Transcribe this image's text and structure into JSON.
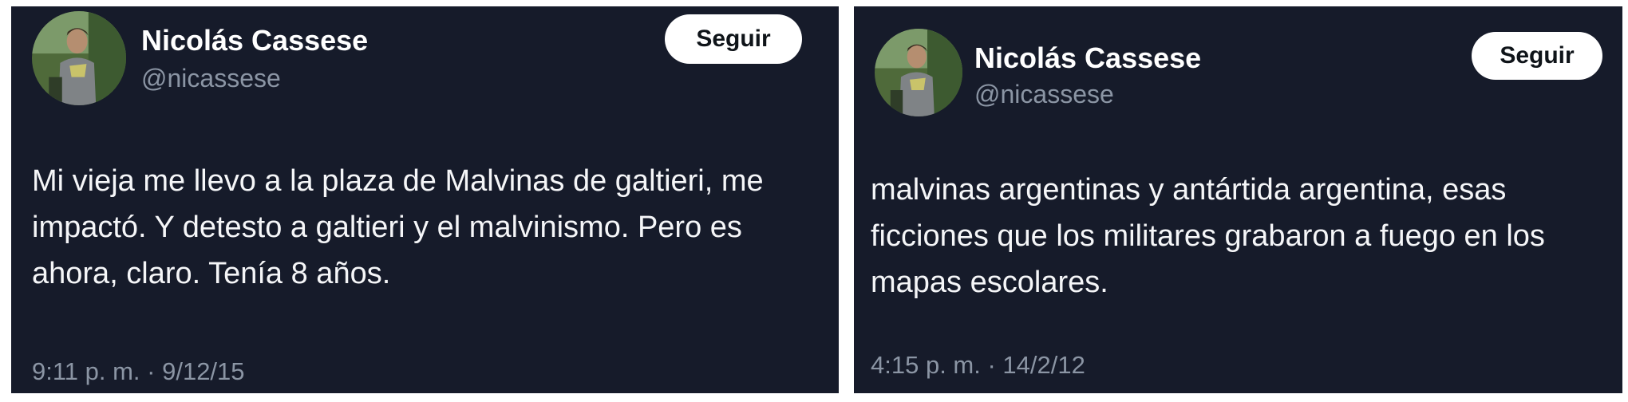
{
  "tweets": [
    {
      "author_name": "Nicolás Cassese",
      "handle": "@nicassese",
      "follow_label": "Seguir",
      "text": "Mi vieja me llevo a la plaza de Malvinas de galtieri, me impactó. Y detesto a galtieri y el malvinismo. Pero es ahora, claro. Tenía 8 años.",
      "timestamp": "9:11 p. m. · 9/12/15"
    },
    {
      "author_name": "Nicolás Cassese",
      "handle": "@nicassese",
      "follow_label": "Seguir",
      "text": "malvinas argentinas y antártida argentina, esas ficciones que los militares grabaron a fuego en los mapas escolares.",
      "timestamp": "4:15 p. m. · 14/2/12"
    }
  ],
  "colors": {
    "card_background": "#161b2a",
    "text_primary": "#f5f6f8",
    "text_secondary": "#8b95a4",
    "follow_button_bg": "#ffffff",
    "follow_button_text": "#0f1419"
  }
}
